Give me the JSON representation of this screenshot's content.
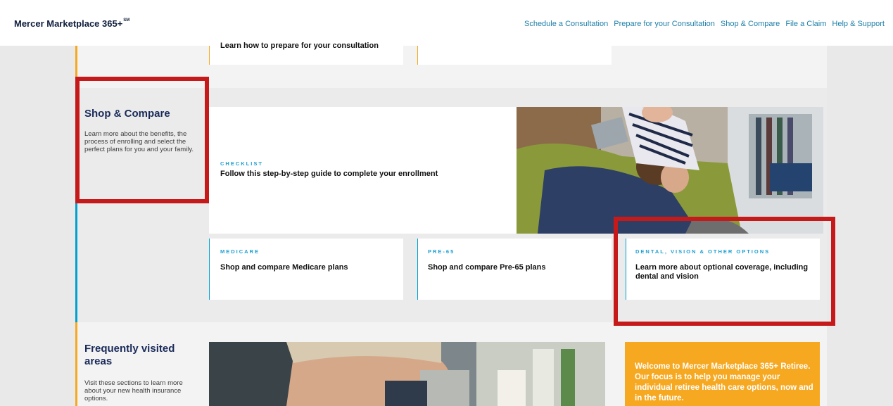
{
  "header": {
    "brand": "Mercer Marketplace 365+",
    "brand_mark": "SM",
    "nav": [
      "Schedule a Consultation",
      "Prepare for your Consultation",
      "Shop & Compare",
      "File a Claim",
      "Help & Support"
    ]
  },
  "prev_section": {
    "card_text": "Learn how to prepare for your consultation"
  },
  "shop": {
    "title": "Shop & Compare",
    "description": "Learn more about the benefits, the process of enrolling and select the perfect plans for you and your family.",
    "checklist": {
      "eyebrow": "CHECKLIST",
      "title": "Follow this step-by-step guide to complete your enrollment"
    },
    "cards": [
      {
        "eyebrow": "MEDICARE",
        "title": "Shop and compare Medicare plans"
      },
      {
        "eyebrow": "PRE-65",
        "title": "Shop and compare Pre-65 plans"
      },
      {
        "eyebrow": "DENTAL, VISION & OTHER OPTIONS",
        "title": "Learn more about optional coverage, including dental and vision"
      }
    ]
  },
  "faq": {
    "title": "Frequently visited areas",
    "description": "Visit these sections to learn more about your new health insurance options."
  },
  "welcome": {
    "text": "Welcome to Mercer Marketplace 365+ Retiree. Our focus is to help you manage your individual retiree health care options, now and in the future."
  },
  "colors": {
    "accent_orange": "#f6a821",
    "accent_blue": "#00a0d2",
    "navy": "#1a2b5a",
    "highlight_red": "#c61a1a"
  }
}
